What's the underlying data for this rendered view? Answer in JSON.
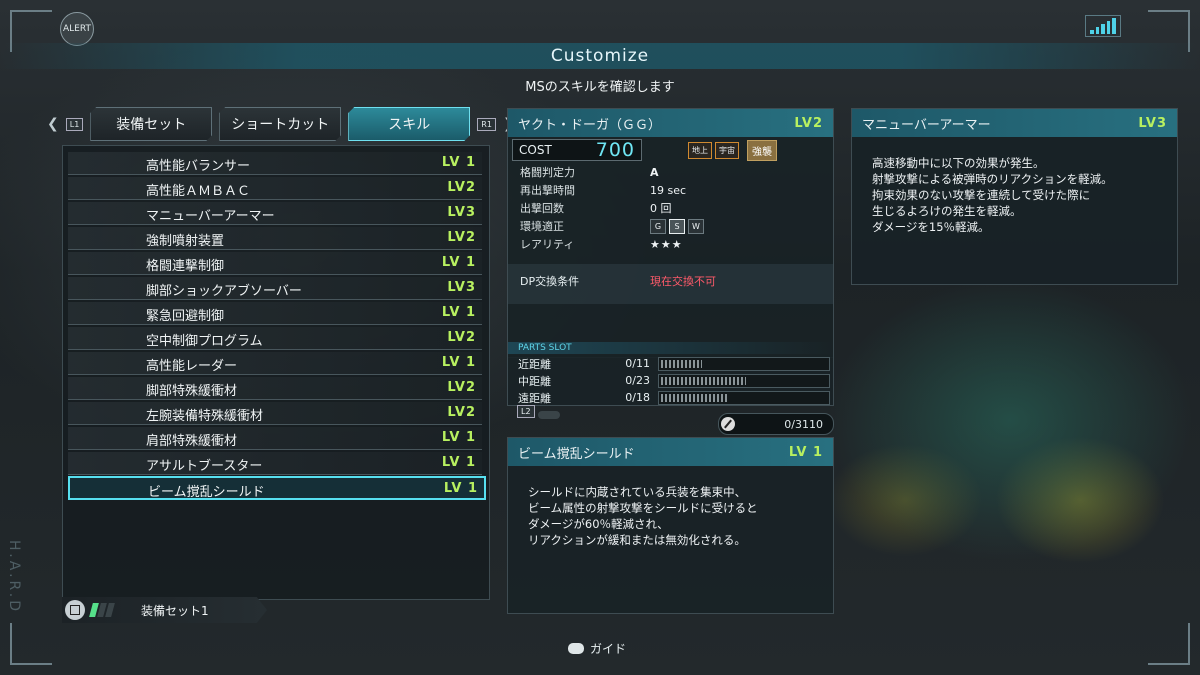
{
  "header": {
    "alert_label": "ALERT",
    "title": "Customize",
    "subtitle": "MSのスキルを確認します"
  },
  "tabs": {
    "left_key": "L1",
    "right_key": "R1",
    "items": [
      {
        "label": "装備セット",
        "active": false
      },
      {
        "label": "ショートカット",
        "active": false
      },
      {
        "label": "スキル",
        "active": true
      }
    ]
  },
  "skills": [
    {
      "name": "高性能バランサー",
      "level": "LV 1"
    },
    {
      "name": "高性能ＡＭＢＡＣ",
      "level": "LV2"
    },
    {
      "name": "マニューバーアーマー",
      "level": "LV3"
    },
    {
      "name": "強制噴射装置",
      "level": "LV2"
    },
    {
      "name": "格闘連撃制御",
      "level": "LV 1"
    },
    {
      "name": "脚部ショックアブソーバー",
      "level": "LV3"
    },
    {
      "name": "緊急回避制御",
      "level": "LV 1"
    },
    {
      "name": "空中制御プログラム",
      "level": "LV2"
    },
    {
      "name": "高性能レーダー",
      "level": "LV 1"
    },
    {
      "name": "脚部特殊緩衝材",
      "level": "LV2"
    },
    {
      "name": "左腕装備特殊緩衝材",
      "level": "LV2"
    },
    {
      "name": "肩部特殊緩衝材",
      "level": "LV 1"
    },
    {
      "name": "アサルトブースター",
      "level": "LV 1"
    },
    {
      "name": "ビーム撹乱シールド",
      "level": "LV 1",
      "selected": true
    }
  ],
  "loadout": {
    "label": "装備セット1",
    "side_text": "H.A.R.D"
  },
  "ms": {
    "name": "ヤクト・ドーガ（ＧＧ）",
    "level": "LV2",
    "cost_label": "COST",
    "cost_value": "700",
    "terrain": [
      "地上",
      "宇宙"
    ],
    "tag": "強襲",
    "stats": [
      {
        "key": "格闘判定力",
        "value": "A"
      },
      {
        "key": "再出撃時間",
        "value": "19 sec"
      },
      {
        "key": "出撃回数",
        "value": "0 回"
      },
      {
        "key": "環境適正",
        "value": ""
      },
      {
        "key": "レアリティ",
        "value": "★★★"
      }
    ],
    "environments": [
      "G",
      "S",
      "W"
    ],
    "dp_label": "DP交換条件",
    "dp_value": "現在交換不可",
    "parts_title": "PARTS SLOT",
    "slots": [
      {
        "range": "近距離",
        "count": "0/11",
        "fill": 0.24
      },
      {
        "range": "中距離",
        "count": "0/23",
        "fill": 0.5
      },
      {
        "range": "遠距離",
        "count": "0/18",
        "fill": 0.39
      }
    ],
    "l2_key": "L2",
    "parts_total": "0/3110"
  },
  "selected_skill": {
    "name": "ビーム撹乱シールド",
    "level": "LV 1",
    "lines": [
      "シールドに内蔵されている兵装を集束中、",
      "ビーム属性の射撃攻撃をシールドに受けると",
      "ダメージが60％軽減され、",
      "リアクションが緩和または無効化される。"
    ]
  },
  "detail_skill": {
    "name": "マニューバーアーマー",
    "level": "LV3",
    "lines": [
      "高速移動中に以下の効果が発生。",
      "射撃攻撃による被弾時のリアクションを軽減。",
      "拘束効果のない攻撃を連続して受けた際に",
      "生じるよろけの発生を軽減。",
      "ダメージを15％軽減。"
    ]
  },
  "guide": {
    "label": "ガイド"
  }
}
